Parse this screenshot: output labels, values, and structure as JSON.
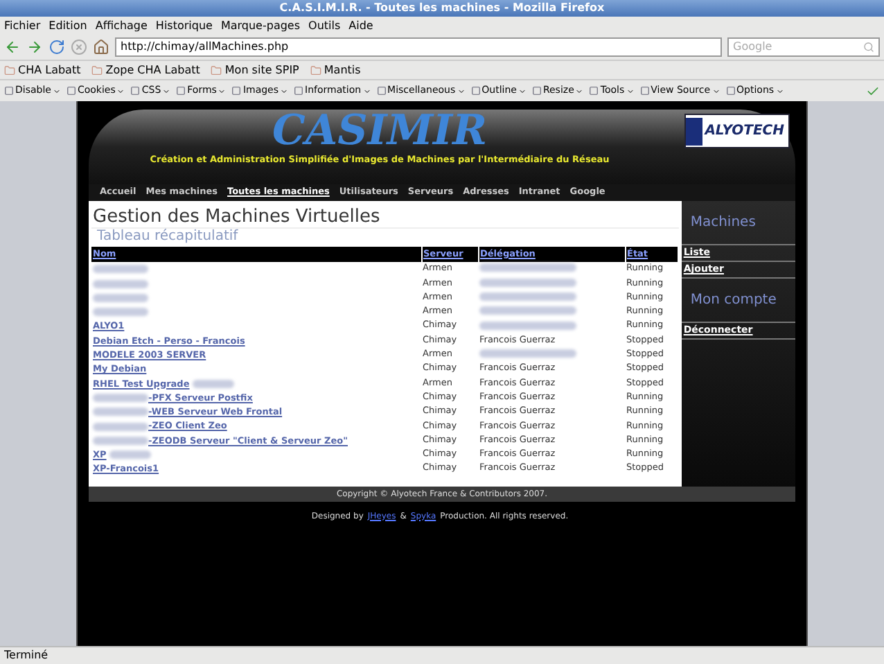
{
  "browser": {
    "title": "C.A.S.I.M.I.R. - Toutes les machines - Mozilla Firefox",
    "menu": [
      "Fichier",
      "Edition",
      "Affichage",
      "Historique",
      "Marque-pages",
      "Outils",
      "Aide"
    ],
    "url": "http://chimay/allMachines.php",
    "search_placeholder": "Google",
    "bookmarks": [
      "CHA Labatt",
      "Zope CHA Labatt",
      "Mon site SPIP",
      "Mantis"
    ],
    "dev_toolbar": [
      "Disable",
      "Cookies",
      "CSS",
      "Forms",
      "Images",
      "Information",
      "Miscellaneous",
      "Outline",
      "Resize",
      "Tools",
      "View Source",
      "Options"
    ],
    "status": "Terminé"
  },
  "page": {
    "logo": "CASIMIR",
    "tagline": "Création et Administration Simplifiée d'Images de Machines par l'Intermédiaire du Réseau",
    "partner_logo": "ALYOTECH",
    "nav": [
      {
        "label": "Accueil",
        "selected": false
      },
      {
        "label": "Mes machines",
        "selected": false
      },
      {
        "label": "Toutes les machines",
        "selected": true
      },
      {
        "label": "Utilisateurs",
        "selected": false
      },
      {
        "label": "Serveurs",
        "selected": false
      },
      {
        "label": "Adresses",
        "selected": false
      },
      {
        "label": "Intranet",
        "selected": false
      },
      {
        "label": "Google",
        "selected": false
      }
    ],
    "heading": "Gestion des Machines Virtuelles",
    "subheading": "Tableau récapitulatif",
    "columns": [
      "Nom",
      "Serveur",
      "Délégation",
      "État"
    ],
    "rows": [
      {
        "kind": "blurred",
        "server": "Armen",
        "state": "Running"
      },
      {
        "kind": "blurred",
        "server": "Armen",
        "state": "Running"
      },
      {
        "kind": "blurred",
        "server": "Armen",
        "state": "Running"
      },
      {
        "kind": "blurred",
        "server": "Armen",
        "state": "Running"
      },
      {
        "name": "ALYO1",
        "kind": "plain",
        "server": "Chimay",
        "state": "Running"
      },
      {
        "name": "Debian Etch - Perso - Francois",
        "kind": "plain",
        "server": "Chimay",
        "delegation": "Francois Guerraz",
        "state": "Stopped"
      },
      {
        "name": "MODELE 2003 SERVER",
        "kind": "plain",
        "server": "Armen",
        "state": "Stopped"
      },
      {
        "name": "My Debian",
        "kind": "plain",
        "server": "Chimay",
        "delegation": "Francois Guerraz",
        "state": "Stopped"
      },
      {
        "name": "RHEL Test Upgrade",
        "kind": "blurred_suffix",
        "server": "Armen",
        "delegation": "Francois Guerraz",
        "state": "Stopped"
      },
      {
        "name": "-PFX Serveur Postfix",
        "kind": "blurred_prefix",
        "server": "Chimay",
        "delegation": "Francois Guerraz",
        "state": "Running"
      },
      {
        "name": "-WEB Serveur Web Frontal",
        "kind": "blurred_prefix",
        "server": "Chimay",
        "delegation": "Francois Guerraz",
        "state": "Running"
      },
      {
        "name": "-ZEO Client Zeo",
        "kind": "blurred_prefix",
        "server": "Chimay",
        "delegation": "Francois Guerraz",
        "state": "Running"
      },
      {
        "name": "-ZEODB Serveur \"Client & Serveur Zeo\"",
        "kind": "blurred_prefix",
        "server": "Chimay",
        "delegation": "Francois Guerraz",
        "state": "Running"
      },
      {
        "name": "XP",
        "kind": "blurred_suffix",
        "server": "Chimay",
        "delegation": "Francois Guerraz",
        "state": "Running"
      },
      {
        "name": "XP-Francois1",
        "kind": "plain",
        "server": "Chimay",
        "delegation": "Francois Guerraz",
        "state": "Stopped"
      }
    ],
    "sidebar": [
      {
        "title": "Machines",
        "links": [
          "Liste",
          "Ajouter"
        ]
      },
      {
        "title": "Mon compte",
        "links": [
          "Déconnecter"
        ]
      }
    ],
    "copyright": "Copyright © Alyotech France & Contributors 2007.",
    "credit": [
      {
        "kind": "text",
        "text": "Designed by"
      },
      {
        "kind": "link",
        "text": "JHeyes"
      },
      {
        "kind": "text",
        "text": "&"
      },
      {
        "kind": "link",
        "text": "Spyka"
      },
      {
        "kind": "text",
        "text": "Production. All rights reserved."
      }
    ]
  }
}
